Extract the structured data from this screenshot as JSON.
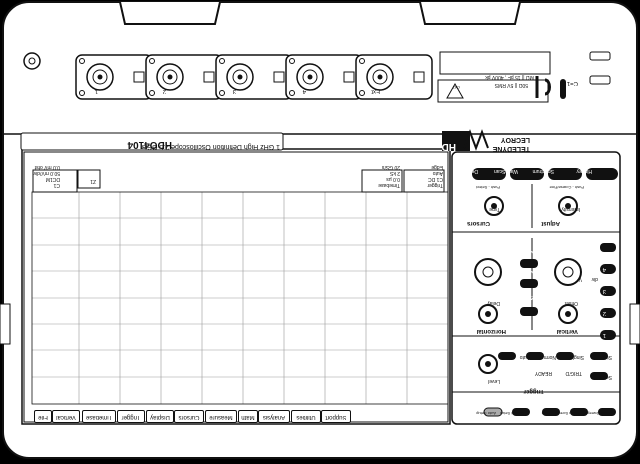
{
  "device": {
    "model": "HDO4104",
    "description": "1 GHz High Definition Oscilloscope  2.5 GS/s",
    "brand_line1": "TELEDYNE",
    "brand_line2": "LECROY",
    "hd_badge": "HD",
    "hd_badge_top": "12-bit"
  },
  "channels": [
    {
      "label": "1"
    },
    {
      "label": "2"
    },
    {
      "label": "3"
    },
    {
      "label": "4"
    },
    {
      "label": "Ext"
    }
  ],
  "rating": {
    "line1": "1 MΩ || 15 pF , 400V pk",
    "line2": "50Ω || 5V RMS",
    "side": "CAT"
  },
  "ground_label": "C=1",
  "menu_bar": {
    "items": [
      "File",
      "Vertical",
      "Timebase",
      "Trigger",
      "Display",
      "Cursors",
      "Measure",
      "Math",
      "Analysis",
      "Utilities",
      "Support"
    ]
  },
  "screen": {
    "c1_box": {
      "title": "C1",
      "l1": "DC1M",
      "l2": "50.0 mV/div",
      "l3": "0.0 mV ofst"
    },
    "timebase_box": {
      "title": "Timebase",
      "l1": "0.0 μs",
      "l2": "2 kS",
      "l3": "20 GS/s"
    },
    "trigger_box": {
      "title": "Trigger",
      "l1": "C1 DC",
      "l2": "Auto",
      "l3": "Edge"
    },
    "c2_tag": "Z1"
  },
  "panel": {
    "top_buttons": [
      "Decode",
      "WaveScan",
      "Spectrum",
      "History"
    ],
    "cursors": {
      "title": "Cursors",
      "knob_label": "Type",
      "top_label": "Push - Select"
    },
    "adjust": {
      "title": "Adjust",
      "knob_label": "Intensity",
      "top_label": "Push - Coarse/Fine"
    },
    "horizontal": {
      "title": "Horizontal",
      "delay": "Delay",
      "zoom": "Zoom",
      "math": "Math",
      "push_zero": "Push - Zero",
      "push_finecoarse": "Push - Fine"
    },
    "vertical": {
      "title": "Vertical",
      "offset": "Offset",
      "mem": "Mem",
      "volts": "V",
      "div": "div",
      "ch_buttons": [
        "1",
        "2",
        "3",
        "4"
      ],
      "push_zero": "Push - Zero",
      "push_fine": "Push - Fine"
    },
    "trigger": {
      "title": "Trigger",
      "level": "Level",
      "auto": "Auto",
      "normal": "Normal",
      "single": "Single",
      "stop": "Stop",
      "setup": "Setup",
      "ready": "READY",
      "trigd": "TRIG'D",
      "push_fine": "Push - Fine"
    },
    "bottom_buttons": [
      "Auto Setup",
      "Default Setup",
      "Print",
      "Touch Screen",
      "Clear Sweeps"
    ]
  }
}
